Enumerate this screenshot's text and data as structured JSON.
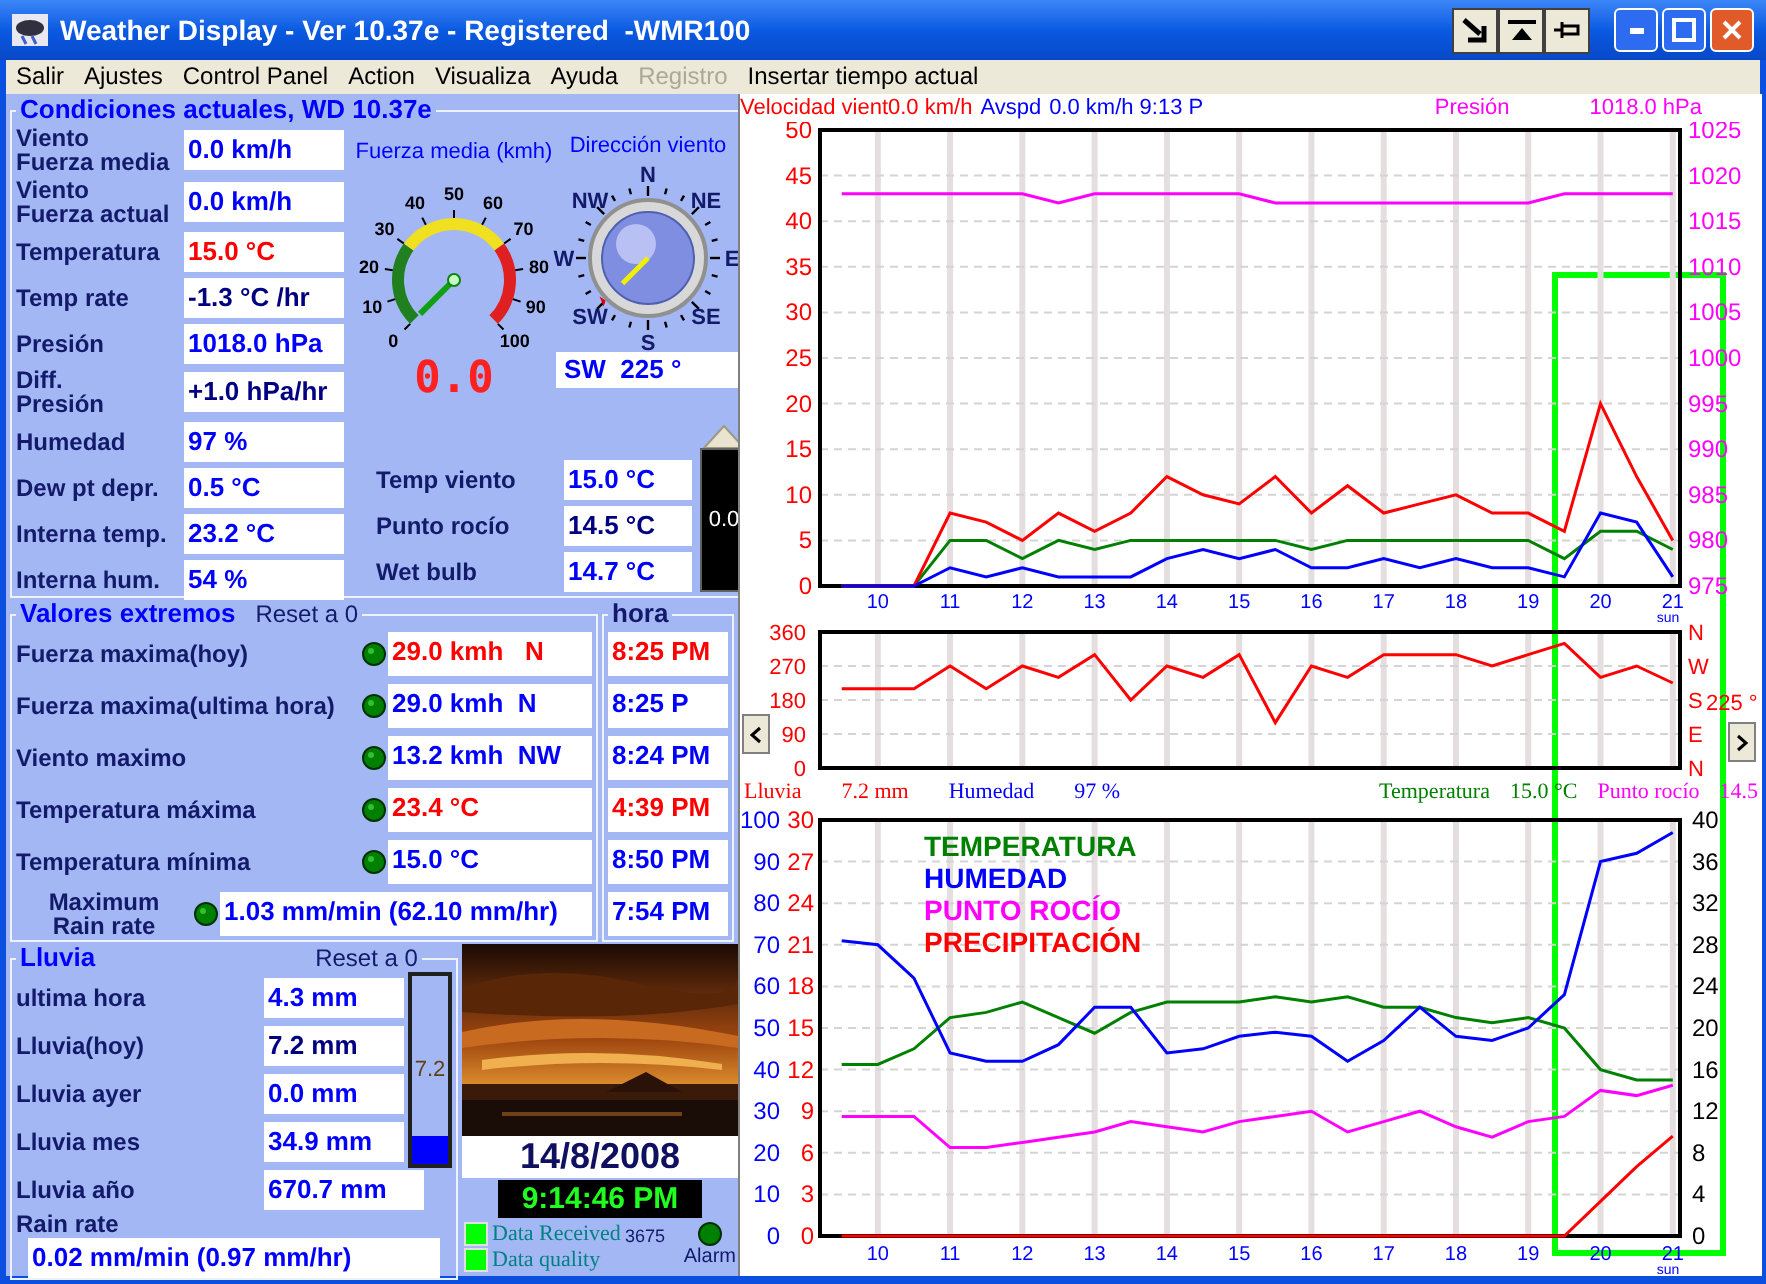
{
  "window": {
    "title": "Weather Display - Ver 10.37e - Registered  -WMR100"
  },
  "menu": [
    {
      "label": "Salir",
      "disabled": false
    },
    {
      "label": "Ajustes",
      "disabled": false
    },
    {
      "label": "Control Panel",
      "disabled": false
    },
    {
      "label": "Action",
      "disabled": false
    },
    {
      "label": "Visualiza",
      "disabled": false
    },
    {
      "label": "Ayuda",
      "disabled": false
    },
    {
      "label": "Registro",
      "disabled": true
    },
    {
      "label": "Insertar tiempo actual",
      "disabled": false
    }
  ],
  "conditions": {
    "title": "Condiciones actuales, WD 10.37e",
    "fields": [
      {
        "label": "Viento\nFuerza media",
        "value": "0.0 km/h",
        "color": "#0000ff"
      },
      {
        "label": "Viento\nFuerza actual",
        "value": "0.0 km/h",
        "color": "#0000ff"
      },
      {
        "label": "Temperatura",
        "value": "15.0 °C",
        "color": "#ff0000"
      },
      {
        "label": "Temp rate",
        "value": "-1.3 °C /hr",
        "color": "#000080"
      },
      {
        "label": "Presión",
        "value": "1018.0 hPa",
        "color": "#0000ff"
      },
      {
        "label": "Diff.\nPresión",
        "value": "+1.0 hPa/hr",
        "color": "#000080"
      },
      {
        "label": "Humedad",
        "value": "97 %",
        "color": "#0000ff"
      },
      {
        "label": "Dew pt depr.",
        "value": "0.5 °C",
        "color": "#0000ff"
      },
      {
        "label": "Interna temp.",
        "value": "23.2 °C",
        "color": "#0000ff"
      },
      {
        "label": "Interna hum.",
        "value": "54 %",
        "color": "#0000ff"
      }
    ],
    "wind_gauge": {
      "title": "Fuerza media (kmh)",
      "ticks": [
        "0",
        "10",
        "20",
        "30",
        "40",
        "50",
        "60",
        "70",
        "80",
        "90",
        "100"
      ],
      "display": "0.0"
    },
    "compass": {
      "title": "Dirección viento",
      "points": [
        "N",
        "NE",
        "E",
        "SE",
        "S",
        "SW",
        "W",
        "NW"
      ],
      "reading": "SW  225 °"
    },
    "extra": [
      {
        "label": "Temp viento",
        "value": "15.0 °C",
        "color": "#0000ff"
      },
      {
        "label": "Punto rocío",
        "value": "14.5 °C",
        "color": "#000080"
      },
      {
        "label": "Wet bulb",
        "value": "14.7 °C",
        "color": "#0000ff"
      }
    ],
    "meter": {
      "value": "0.0",
      "level": 0
    }
  },
  "extremes": {
    "title": "Valores extremos",
    "reset": "Reset a 0",
    "time_title": "hora",
    "rows": [
      {
        "kind": "standard",
        "label": "Fuerza maxima(hoy)",
        "value": "29.0 kmh   N",
        "time": "8:25 PM",
        "color": "#ff0000"
      },
      {
        "kind": "standard",
        "label": "Fuerza maxima(ultima hora)",
        "value": "29.0 kmh  N",
        "time": "8:25 P",
        "color": "#0000ff"
      },
      {
        "kind": "standard",
        "label": "Viento maximo",
        "value": "13.2 kmh  NW",
        "time": "8:24 PM",
        "color": "#0000ff"
      },
      {
        "kind": "standard",
        "label": "Temperatura máxima",
        "value": "23.4 °C",
        "time": "4:39 PM",
        "color": "#ff0000"
      },
      {
        "kind": "standard",
        "label": "Temperatura mínima",
        "value": "15.0 °C",
        "time": "8:50 PM",
        "color": "#0000ff"
      },
      {
        "kind": "wide",
        "label": "Maximum\nRain rate",
        "value": "1.03 mm/min (62.10 mm/hr)",
        "time": "7:54 PM",
        "color": "#0000ff"
      }
    ]
  },
  "rain": {
    "title": "Lluvia",
    "reset": "Reset a 0",
    "rows": [
      {
        "label": "ultima hora",
        "value": "4.3 mm",
        "color": "#0000ff"
      },
      {
        "label": "Lluvia(hoy)",
        "value": "7.2 mm",
        "color": "#000080"
      },
      {
        "label": "Lluvia ayer",
        "value": "0.0 mm",
        "color": "#0000ff"
      },
      {
        "label": "Lluvia mes",
        "value": "34.9 mm",
        "color": "#0000ff"
      },
      {
        "label": "Lluvia año",
        "value": "670.7 mm",
        "color": "#0000ff"
      }
    ],
    "gauge": {
      "value": "7.2",
      "level": 0.15
    },
    "rate_label": "Rain rate",
    "rate": "0.02 mm/min (0.97 mm/hr)"
  },
  "clock": {
    "date": "14/8/2008",
    "time": "9:14:46 PM",
    "indicators": [
      {
        "label": "Data Received",
        "on": true
      },
      {
        "label": "Data quality",
        "on": true
      }
    ],
    "count": "3675",
    "alarm": "Alarm"
  },
  "wind_header": {
    "left": [
      {
        "text": "Velocidad vient0.0 km/h",
        "color": "#ff0000"
      },
      {
        "text": "Avspd",
        "color": "#0000ff"
      },
      {
        "text": "0.0 km/h 9:13 P",
        "color": "#0000ff"
      }
    ],
    "right": [
      {
        "text": "Presión",
        "color": "#ff00ff"
      },
      {
        "text": "1018.0 hPa",
        "color": "#ff00ff"
      }
    ]
  },
  "wind_chart": {
    "chart_data": {
      "type": "line",
      "grid": true,
      "xlim": [
        9.2,
        21.1
      ],
      "ylim": [
        0,
        50
      ],
      "y2lim": [
        975,
        1025
      ],
      "x": [
        9.5,
        10,
        10.5,
        11,
        11.5,
        12,
        12.5,
        13,
        13.5,
        14,
        14.5,
        15,
        15.5,
        16,
        16.5,
        17,
        17.5,
        18,
        18.5,
        19,
        19.5,
        20,
        20.5,
        21
      ],
      "xticks": [
        10,
        11,
        12,
        13,
        14,
        15,
        16,
        17,
        18,
        19,
        20,
        21
      ],
      "yticks": [
        0,
        5,
        10,
        15,
        20,
        25,
        30,
        35,
        40,
        45,
        50
      ],
      "y2ticks": [
        975,
        980,
        985,
        990,
        995,
        1000,
        1005,
        1010,
        1015,
        1020,
        1025
      ],
      "series": [
        {
          "color": "#008000",
          "axis": "y",
          "values": [
            0,
            0,
            0,
            5,
            5,
            3,
            5,
            4,
            5,
            5,
            5,
            5,
            5,
            4,
            5,
            5,
            5,
            5,
            5,
            5,
            3,
            6,
            6,
            4
          ]
        },
        {
          "color": "#ff0000",
          "axis": "y",
          "values": [
            0,
            0,
            0,
            8,
            7,
            5,
            8,
            6,
            8,
            12,
            10,
            9,
            12,
            8,
            11,
            8,
            9,
            10,
            8,
            8,
            6,
            20,
            12,
            5
          ]
        },
        {
          "color": "#0000ff",
          "axis": "y",
          "values": [
            0,
            0,
            0,
            2,
            1,
            2,
            1,
            1,
            1,
            3,
            4,
            3,
            4,
            2,
            2,
            3,
            2,
            3,
            2,
            2,
            1,
            8,
            7,
            1
          ]
        },
        {
          "color": "#ff00ff",
          "axis": "y2",
          "values": [
            1018,
            1018,
            1018,
            1018,
            1018,
            1018,
            1017,
            1018,
            1018,
            1018,
            1018,
            1018,
            1017,
            1017,
            1017,
            1017,
            1017,
            1017,
            1017,
            1017,
            1018,
            1018,
            1018,
            1018
          ]
        }
      ],
      "annotations": [
        {
          "text": "sun"
        }
      ]
    }
  },
  "direction_chart": {
    "compass_labels": [
      "N",
      "W",
      "S",
      "E",
      "N"
    ],
    "chart_data": {
      "type": "line",
      "grid": true,
      "xlim": [
        9.2,
        21.1
      ],
      "ylim": [
        0,
        360
      ],
      "x": [
        9.5,
        10,
        10.5,
        11,
        11.5,
        12,
        12.5,
        13,
        13.5,
        14,
        14.5,
        15,
        15.5,
        16,
        16.5,
        17,
        17.5,
        18,
        18.5,
        19,
        19.5,
        20,
        20.5,
        21
      ],
      "yticks": [
        0,
        90,
        180,
        270,
        360
      ],
      "series": [
        {
          "color": "#ff0000",
          "axis": "y",
          "values": [
            210,
            210,
            210,
            270,
            210,
            270,
            240,
            300,
            180,
            270,
            240,
            300,
            120,
            270,
            240,
            300,
            300,
            300,
            270,
            300,
            330,
            240,
            270,
            225
          ]
        }
      ],
      "annotations": [
        {
          "text": "225 °"
        }
      ]
    }
  },
  "readings": {
    "left": [
      {
        "text": "Lluvia",
        "color": "#ff0000"
      },
      {
        "text": "7.2 mm",
        "color": "#ff0000"
      },
      {
        "text": "Humedad",
        "color": "#0000ff"
      },
      {
        "text": "97 %",
        "color": "#0000ff"
      }
    ],
    "right": [
      {
        "text": "Temperatura",
        "color": "#008000"
      },
      {
        "text": "15.0 °C",
        "color": "#008000"
      },
      {
        "text": "Punto rocío",
        "color": "#ff00ff"
      },
      {
        "text": "14.5",
        "color": "#ff00ff"
      }
    ]
  },
  "climate_chart": {
    "chart_data": {
      "type": "line",
      "grid": true,
      "xlim": [
        9.2,
        21.1
      ],
      "ylim": [
        0,
        100
      ],
      "y2lim": [
        0,
        30
      ],
      "y3lim": [
        0,
        40
      ],
      "x": [
        9.5,
        10,
        10.5,
        11,
        11.5,
        12,
        12.5,
        13,
        13.5,
        14,
        14.5,
        15,
        15.5,
        16,
        16.5,
        17,
        17.5,
        18,
        18.5,
        19,
        19.5,
        20,
        20.5,
        21
      ],
      "xticks": [
        10,
        11,
        12,
        13,
        14,
        15,
        16,
        17,
        18,
        19,
        20,
        21
      ],
      "yticks": [
        0,
        10,
        20,
        30,
        40,
        50,
        60,
        70,
        80,
        90,
        100
      ],
      "y2ticks": [
        0,
        3,
        6,
        9,
        12,
        15,
        18,
        21,
        24,
        27,
        30
      ],
      "y3ticks": [
        0,
        4,
        8,
        12,
        16,
        20,
        24,
        28,
        32,
        36,
        40
      ],
      "series": [
        {
          "name": "TEMPERATURA",
          "color": "#008000",
          "axis": "y3",
          "values": [
            16.5,
            16.5,
            18,
            21,
            21.5,
            22.5,
            21,
            19.5,
            21.5,
            22.5,
            22.5,
            22.5,
            23,
            22.5,
            23,
            22,
            22,
            21,
            20.5,
            21,
            20,
            16,
            15,
            15
          ]
        },
        {
          "name": "HUMEDAD",
          "color": "#0000ff",
          "axis": "y",
          "values": [
            71,
            70,
            62,
            44,
            42,
            42,
            46,
            55,
            55,
            44,
            45,
            48,
            49,
            48,
            42,
            47,
            55,
            48,
            47,
            50,
            58,
            90,
            92,
            97
          ]
        },
        {
          "name": "PUNTO ROCÍO",
          "color": "#ff00ff",
          "axis": "y3",
          "values": [
            11.5,
            11.5,
            11.5,
            8.5,
            8.5,
            9,
            9.5,
            10,
            11,
            10.5,
            10,
            11,
            11.5,
            12,
            10,
            11,
            12,
            10.5,
            9.5,
            11,
            11.5,
            14,
            13.5,
            14.5
          ]
        },
        {
          "name": "PRECIPITACIÓN",
          "color": "#ff0000",
          "axis": "y2",
          "values": [
            0,
            0,
            0,
            0,
            0,
            0,
            0,
            0,
            0,
            0,
            0,
            0,
            0,
            0,
            0,
            0,
            0,
            0,
            0,
            0,
            0,
            2.5,
            5,
            7.2
          ]
        }
      ],
      "annotations": [
        {
          "text": "sun"
        }
      ]
    }
  }
}
